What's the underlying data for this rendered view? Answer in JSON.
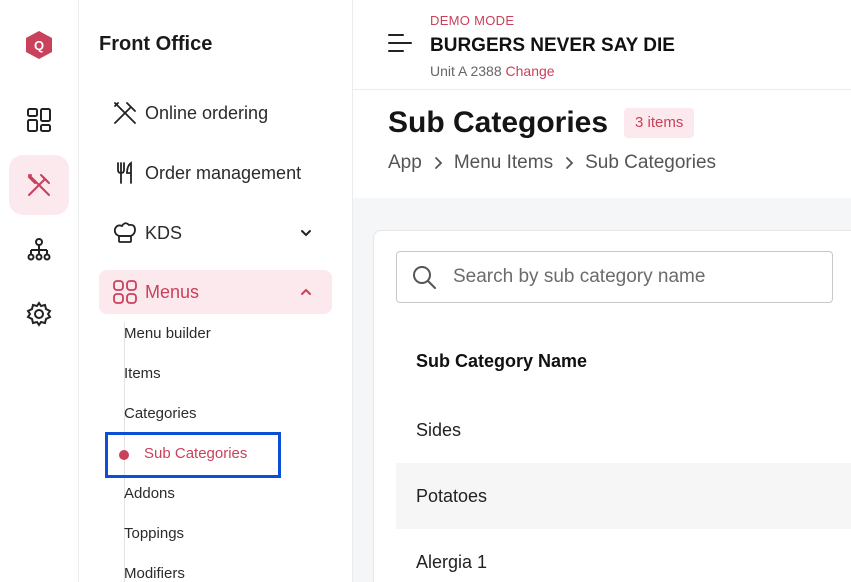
{
  "rail": {
    "icons": [
      "app-logo-icon",
      "dashboard-icon",
      "utensils-icon",
      "organization-icon",
      "settings-gear-icon"
    ],
    "logo_letter": "Q"
  },
  "sidebar": {
    "title": "Front Office",
    "items": [
      {
        "label": "Online ordering",
        "icon": "utensils-cross-icon"
      },
      {
        "label": "Order management",
        "icon": "fork-knife-icon"
      },
      {
        "label": "KDS",
        "icon": "chef-hat-icon",
        "expandable": true,
        "expanded": false
      },
      {
        "label": "Menus",
        "icon": "grid-icon",
        "expandable": true,
        "expanded": true
      }
    ],
    "submenu": [
      {
        "label": "Menu builder"
      },
      {
        "label": "Items"
      },
      {
        "label": "Categories"
      },
      {
        "label": "Sub Categories",
        "active": true
      },
      {
        "label": "Addons"
      },
      {
        "label": "Toppings"
      },
      {
        "label": "Modifiers"
      }
    ]
  },
  "header": {
    "mode": "DEMO MODE",
    "brand": "BURGERS NEVER SAY DIE",
    "unit": "Unit A 2388",
    "change_label": "Change"
  },
  "page": {
    "title": "Sub Categories",
    "badge": "3 items",
    "breadcrumb": [
      "App",
      "Menu Items",
      "Sub Categories"
    ]
  },
  "search": {
    "placeholder": "Search by sub category name",
    "value": ""
  },
  "table": {
    "column": "Sub Category Name",
    "rows": [
      "Sides",
      "Potatoes",
      "Alergia 1"
    ]
  },
  "colors": {
    "accent": "#c9415a",
    "accent_bg": "#fbe9ed",
    "highlight_box": "#0a4fd6"
  }
}
